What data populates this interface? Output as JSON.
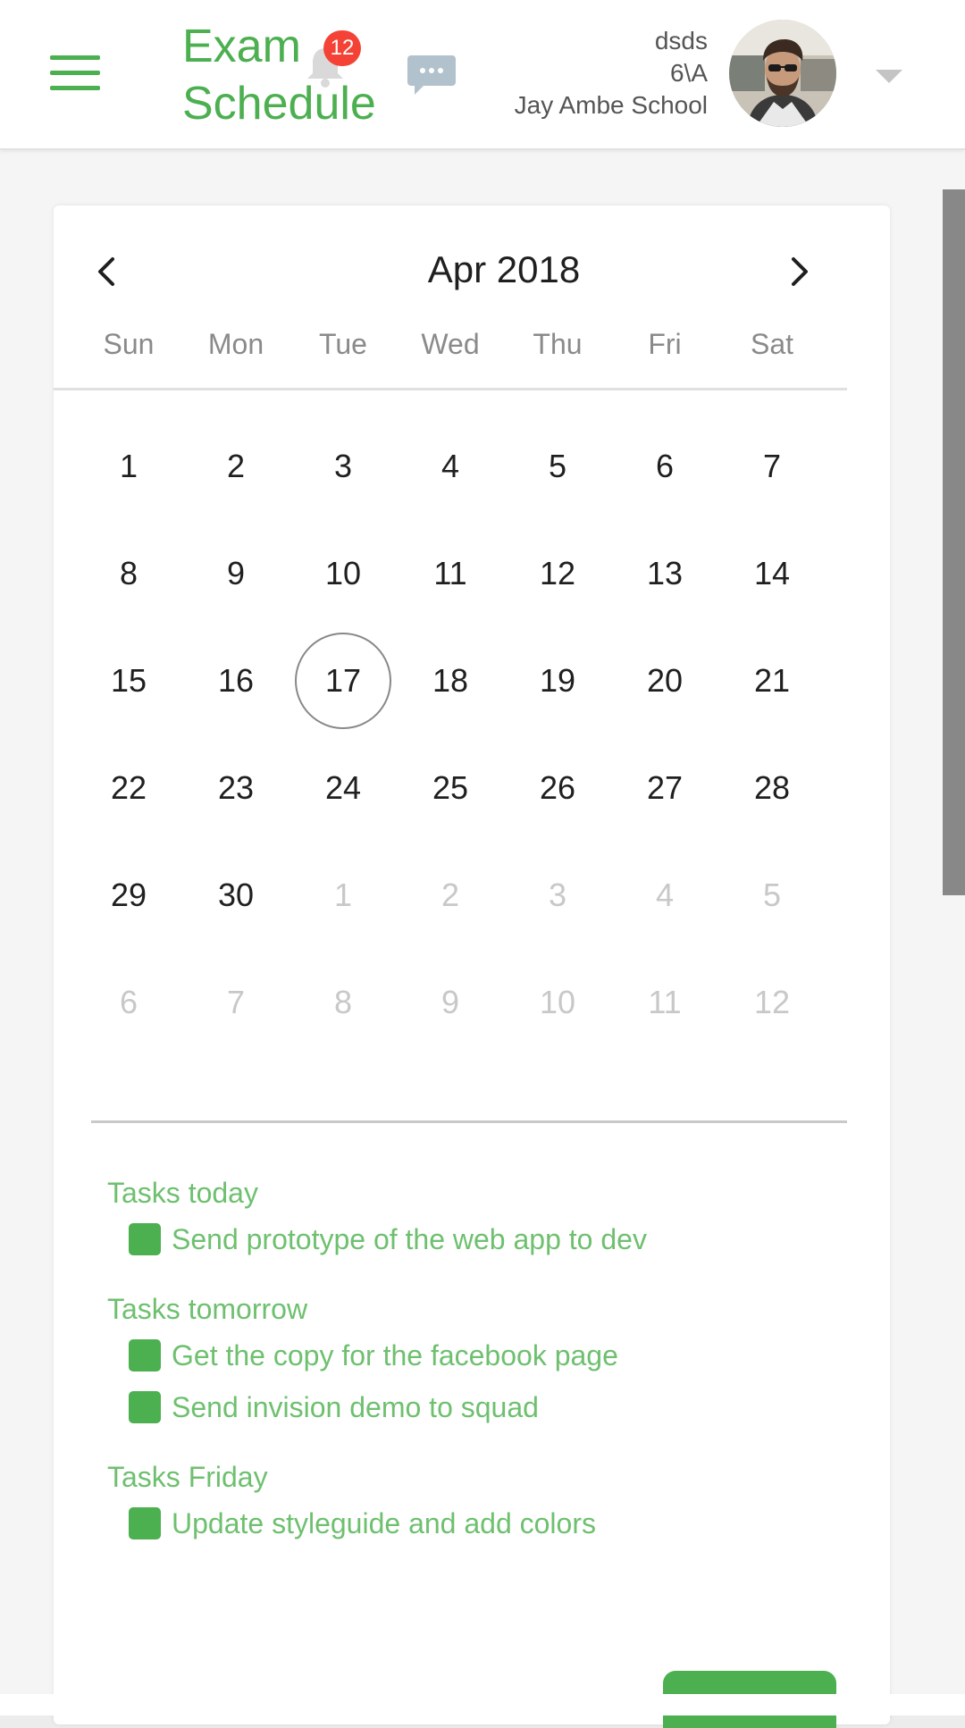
{
  "header": {
    "title_line1": "Exam",
    "title_line2": "Schedule",
    "notification_count": "12",
    "user": {
      "name": "dsds",
      "class": "6\\A",
      "school": "Jay Ambe School"
    },
    "icons": [
      "menu-icon",
      "bell-icon",
      "chat-icon",
      "avatar",
      "chevron-down-icon"
    ],
    "accent_color": "#4caf50",
    "badge_color": "#f44336"
  },
  "calendar": {
    "month_label": "Apr 2018",
    "weekdays": [
      "Sun",
      "Mon",
      "Tue",
      "Wed",
      "Thu",
      "Fri",
      "Sat"
    ],
    "selected_day": "17",
    "weeks": [
      [
        {
          "d": "1",
          "c": true
        },
        {
          "d": "2",
          "c": true
        },
        {
          "d": "3",
          "c": true
        },
        {
          "d": "4",
          "c": true
        },
        {
          "d": "5",
          "c": true
        },
        {
          "d": "6",
          "c": true
        },
        {
          "d": "7",
          "c": true
        }
      ],
      [
        {
          "d": "8",
          "c": true
        },
        {
          "d": "9",
          "c": true
        },
        {
          "d": "10",
          "c": true
        },
        {
          "d": "11",
          "c": true
        },
        {
          "d": "12",
          "c": true
        },
        {
          "d": "13",
          "c": true
        },
        {
          "d": "14",
          "c": true
        }
      ],
      [
        {
          "d": "15",
          "c": true
        },
        {
          "d": "16",
          "c": true
        },
        {
          "d": "17",
          "c": true
        },
        {
          "d": "18",
          "c": true
        },
        {
          "d": "19",
          "c": true
        },
        {
          "d": "20",
          "c": true
        },
        {
          "d": "21",
          "c": true
        }
      ],
      [
        {
          "d": "22",
          "c": true
        },
        {
          "d": "23",
          "c": true
        },
        {
          "d": "24",
          "c": true
        },
        {
          "d": "25",
          "c": true
        },
        {
          "d": "26",
          "c": true
        },
        {
          "d": "27",
          "c": true
        },
        {
          "d": "28",
          "c": true
        }
      ],
      [
        {
          "d": "29",
          "c": true
        },
        {
          "d": "30",
          "c": true
        },
        {
          "d": "1",
          "c": false
        },
        {
          "d": "2",
          "c": false
        },
        {
          "d": "3",
          "c": false
        },
        {
          "d": "4",
          "c": false
        },
        {
          "d": "5",
          "c": false
        }
      ],
      [
        {
          "d": "6",
          "c": false
        },
        {
          "d": "7",
          "c": false
        },
        {
          "d": "8",
          "c": false
        },
        {
          "d": "9",
          "c": false
        },
        {
          "d": "10",
          "c": false
        },
        {
          "d": "11",
          "c": false
        },
        {
          "d": "12",
          "c": false
        }
      ]
    ]
  },
  "tasks": [
    {
      "title": "Tasks today",
      "items": [
        "Send prototype of the web app to dev"
      ]
    },
    {
      "title": "Tasks tomorrow",
      "items": [
        "Get the copy for the facebook page",
        "Send invision demo to squad"
      ]
    },
    {
      "title": "Tasks Friday",
      "items": [
        "Update styleguide and add colors"
      ]
    }
  ]
}
